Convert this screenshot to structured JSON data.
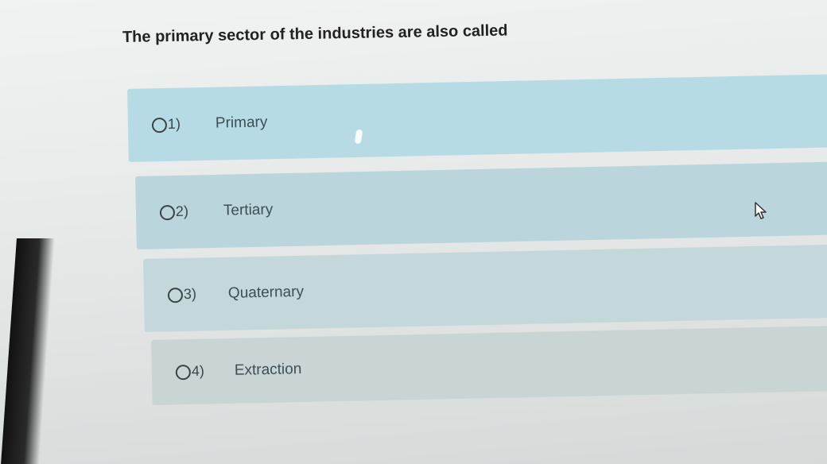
{
  "question": {
    "text": "The primary sector of the industries are also called"
  },
  "options": [
    {
      "number": "1)",
      "label": "Primary",
      "selected": false
    },
    {
      "number": "2)",
      "label": "Tertiary",
      "selected": false
    },
    {
      "number": "3)",
      "label": "Quaternary",
      "selected": false
    },
    {
      "number": "4)",
      "label": "Extraction",
      "selected": false
    }
  ],
  "colors": {
    "option_bg": "#b7dbe5",
    "text": "#3b4f55",
    "question_text": "#222222"
  },
  "icons": {
    "radio": "radio-circle-icon",
    "cursor": "mouse-pointer-icon"
  }
}
